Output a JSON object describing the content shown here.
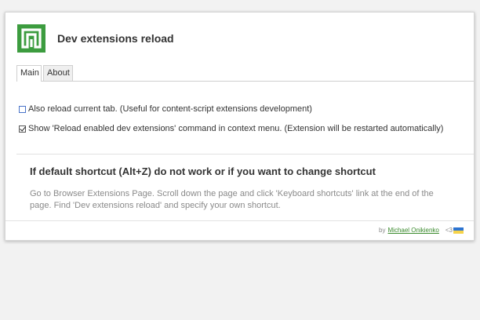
{
  "app": {
    "title": "Dev extensions reload",
    "logo_color": "#3c9c3f",
    "logo_icon": "extension-logo-icon"
  },
  "tabs": [
    {
      "label": "Main",
      "active": true
    },
    {
      "label": "About",
      "active": false
    }
  ],
  "options": [
    {
      "label": "Also reload current tab. (Useful for content-script extensions development)",
      "checked": false
    },
    {
      "label": "Show 'Reload enabled dev extensions' command in context menu. (Extension will be restarted automatically)",
      "checked": true
    }
  ],
  "shortcut_info": {
    "heading": "If default shortcut (Alt+Z) do not work or if you want to change shortcut",
    "body": "Go to Browser Extensions Page. Scroll down the page and click 'Keyboard shortcuts' link at the end of the page. Find 'Dev extensions reload' and specify your own shortcut."
  },
  "footer": {
    "by": "by",
    "author": "Michael Onikienko",
    "heart": "<3",
    "flag_colors": [
      "#2d74d0",
      "#f6d34a"
    ],
    "link_color": "#3a8a2c"
  }
}
